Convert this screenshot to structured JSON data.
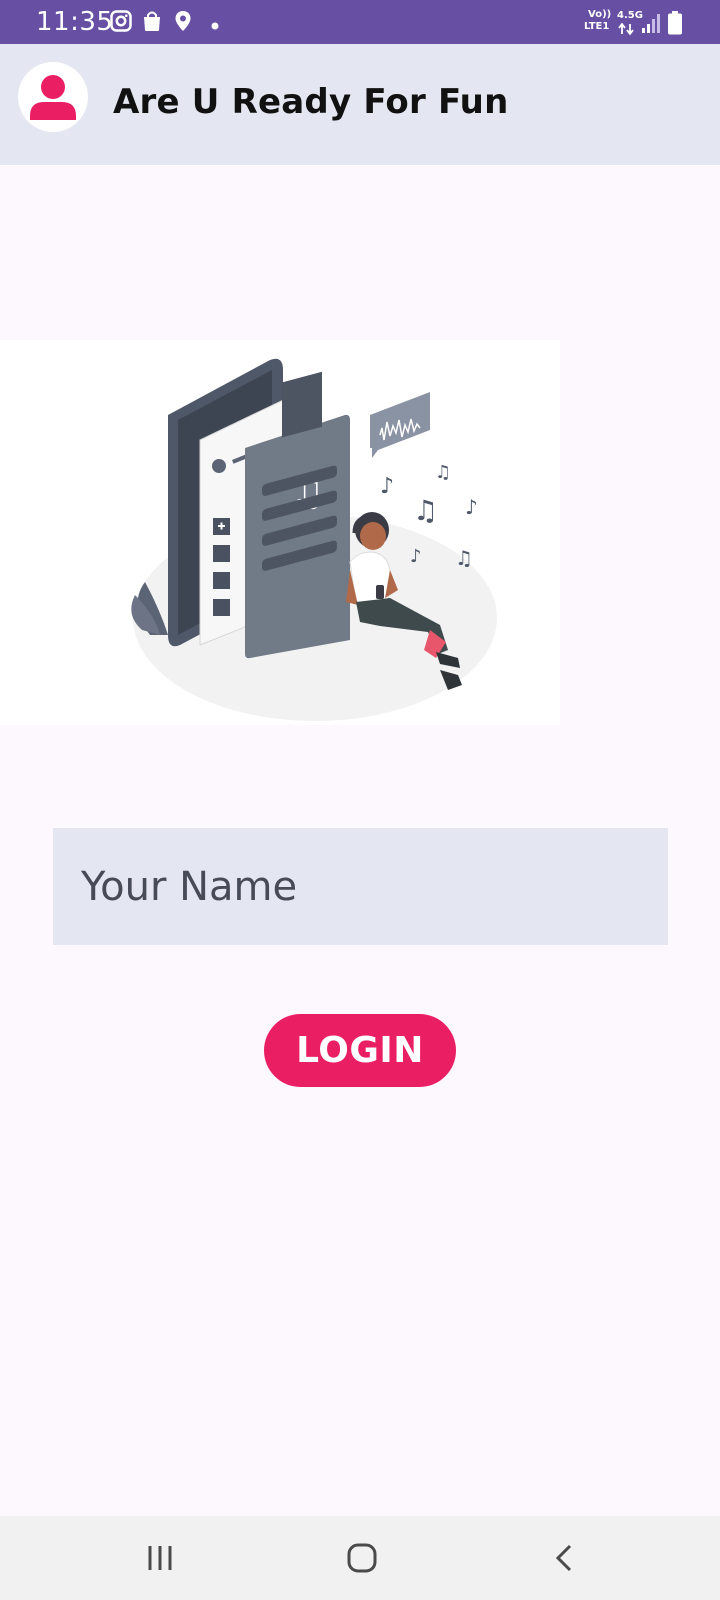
{
  "status_bar": {
    "time": "11:35",
    "left_icons": [
      "instagram-icon",
      "shopping-bag-icon",
      "location-pin-icon",
      "dot-icon"
    ],
    "network_top": "Vo))",
    "network_lte": "LTE1",
    "network_speed": "4.5G",
    "right_icons": [
      "data-arrows-icon",
      "signal-icon",
      "battery-icon"
    ]
  },
  "app_bar": {
    "title": "Are U Ready For Fun",
    "avatar_icon": "person-icon"
  },
  "illustration": {
    "icon": "music-app-illustration"
  },
  "login_form": {
    "name_placeholder": "Your Name",
    "name_value": "",
    "login_label": "LOGIN"
  },
  "nav_bar": {
    "items": [
      "recent-apps-icon",
      "home-icon",
      "back-icon"
    ]
  },
  "colors": {
    "status_bar": "#6750a4",
    "app_bar": "#e4e6f1",
    "accent": "#e91e63",
    "background": "#fdf8fd",
    "input_bg": "#e4e6f1"
  }
}
